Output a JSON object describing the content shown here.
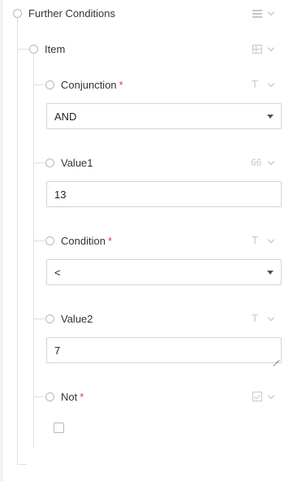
{
  "root": {
    "label": "Further Conditions",
    "type_icon": "list-icon"
  },
  "item": {
    "label": "Item",
    "type_icon": "table-icon"
  },
  "fields": {
    "conjunction": {
      "label": "Conjunction",
      "required_mark": "*",
      "type_icon": "text-type-icon",
      "type_glyph": "T",
      "value": "AND",
      "control": "select"
    },
    "value1": {
      "label": "Value1",
      "type_icon": "quote-icon",
      "type_glyph": "66",
      "value": "13",
      "control": "text-input"
    },
    "condition": {
      "label": "Condition",
      "required_mark": "*",
      "type_icon": "text-type-icon",
      "type_glyph": "T",
      "value": "<",
      "control": "select"
    },
    "value2": {
      "label": "Value2",
      "type_icon": "text-type-icon",
      "type_glyph": "T",
      "value": "7",
      "control": "textarea"
    },
    "not": {
      "label": "Not",
      "required_mark": "*",
      "type_icon": "checkbox-icon",
      "checked": false,
      "control": "checkbox"
    }
  },
  "colors": {
    "required": "#e03a3a",
    "border": "#cfd3d9",
    "tree_line": "#dcdfe4",
    "icon": "#c4c8ce"
  }
}
